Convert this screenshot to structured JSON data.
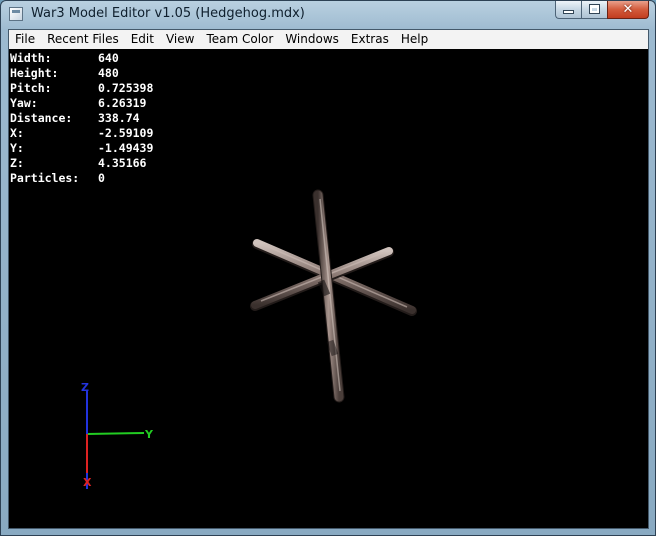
{
  "window": {
    "title": "War3 Model Editor v1.05 (Hedgehog.mdx)",
    "close_glyph": "✕"
  },
  "menu": [
    {
      "label": "File"
    },
    {
      "label": "Recent Files"
    },
    {
      "label": "Edit"
    },
    {
      "label": "View"
    },
    {
      "label": "Team Color"
    },
    {
      "label": "Windows"
    },
    {
      "label": "Extras"
    },
    {
      "label": "Help"
    }
  ],
  "stats": [
    {
      "label": "Width:",
      "value": "640"
    },
    {
      "label": "Height:",
      "value": "480"
    },
    {
      "label": "Pitch:",
      "value": "0.725398"
    },
    {
      "label": "Yaw:",
      "value": "6.26319"
    },
    {
      "label": "Distance:",
      "value": "338.74"
    },
    {
      "label": "X:",
      "value": "-2.59109"
    },
    {
      "label": "Y:",
      "value": "-1.49439"
    },
    {
      "label": "Z:",
      "value": "4.35166"
    },
    {
      "label": "Particles:",
      "value": "0"
    }
  ],
  "axes": {
    "z": {
      "label": "Z",
      "color": "#2233dd"
    },
    "y": {
      "label": "Y",
      "color": "#22cc22"
    },
    "x": {
      "label": "X",
      "color": "#dd2222"
    }
  },
  "colors": {
    "viewport_background": "#000000",
    "stats_text": "#ffffff",
    "spike_base": "#8a7872"
  }
}
